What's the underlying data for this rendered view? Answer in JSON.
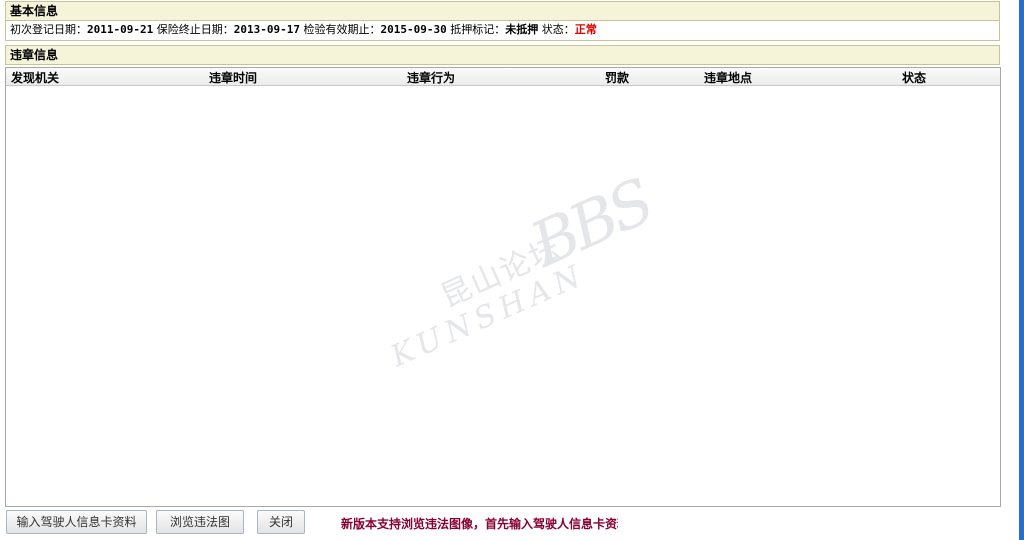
{
  "basic_info": {
    "title": "基本信息",
    "fields": [
      {
        "label": "初次登记日期：",
        "value": "2011-09-21",
        "style": "mono"
      },
      {
        "label": "保险终止日期：",
        "value": "2013-09-17",
        "style": "mono"
      },
      {
        "label": "检验有效期止：",
        "value": "2015-09-30",
        "style": "mono"
      },
      {
        "label": "抵押标记：",
        "value": "未抵押",
        "style": "bold"
      },
      {
        "label": "状态：",
        "value": "正常",
        "style": "red"
      }
    ]
  },
  "violation_info": {
    "title": "违章信息",
    "columns": [
      "发现机关",
      "违章时间",
      "违章行为",
      "罚款",
      "违章地点",
      "状态"
    ],
    "rows": []
  },
  "watermark": {
    "cn": "昆山论坛",
    "en": "KUNSHAN",
    "bbs": "BBS"
  },
  "buttons": {
    "input_card": "输入驾驶人信息卡资料",
    "browse_images": "浏览违法图",
    "close": "关闭"
  },
  "notice": "新版本支持浏览违法图像，首先输入驾驶人信息卡资料",
  "colors": {
    "header_bg": "#f6f4d8",
    "status_ok": "#e00000",
    "notice": "#8b0033",
    "side_bar": "#2a6fc4"
  }
}
